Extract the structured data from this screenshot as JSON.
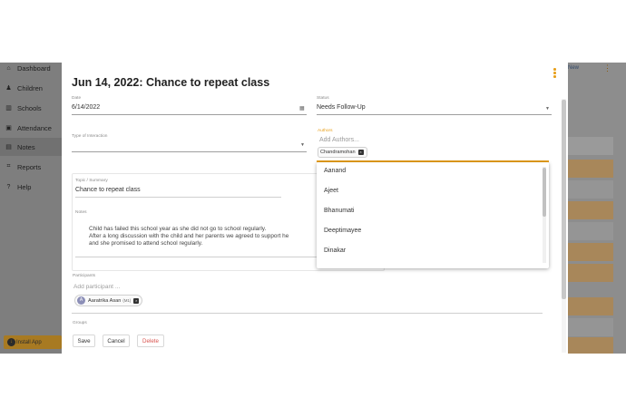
{
  "sidebar": {
    "items": [
      {
        "icon": "home-icon",
        "glyph": "⌂",
        "label": "Dashboard"
      },
      {
        "icon": "child-icon",
        "glyph": "♟",
        "label": "Children"
      },
      {
        "icon": "school-icon",
        "glyph": "▥",
        "label": "Schools"
      },
      {
        "icon": "attendance-icon",
        "glyph": "▣",
        "label": "Attendance"
      },
      {
        "icon": "notes-icon",
        "glyph": "▤",
        "label": "Notes"
      },
      {
        "icon": "chart-icon",
        "glyph": "⌗",
        "label": "Reports"
      },
      {
        "icon": "help-icon",
        "glyph": "?",
        "label": "Help"
      }
    ],
    "install_label": "Install App"
  },
  "background": {
    "new_label": "New"
  },
  "dialog": {
    "title": "Jun 14, 2022: Chance to repeat class",
    "date": {
      "label": "Date",
      "value": "6/14/2022"
    },
    "status": {
      "label": "Status",
      "value": "Needs Follow-Up"
    },
    "type_of_interaction": {
      "label": "Type of Interaction",
      "value": ""
    },
    "authors": {
      "label": "Authors",
      "placeholder": "Add Authors...",
      "chip": "Chandramohan"
    },
    "topic": {
      "label": "Topic / Summary",
      "value": "Chance to repeat class"
    },
    "notes": {
      "label": "Notes",
      "lines": [
        "Child has failed this school year as she did not go to school regularly.",
        "After a long discussion with the child and her parents we agreed to support he",
        "and she promised to attend school regularly."
      ]
    },
    "participants": {
      "label": "Participants",
      "placeholder": "Add participant ...",
      "chip_name": "Aaratrika Asan",
      "chip_sub": "(M1)"
    },
    "groups": {
      "label": "Groups"
    },
    "buttons": {
      "save": "Save",
      "cancel": "Cancel",
      "delete": "Delete"
    }
  },
  "authors_dropdown": {
    "options": [
      "Aanand",
      "Ajeet",
      "Bhanumati",
      "Deeptimayee",
      "Dinakar"
    ]
  },
  "colors": {
    "accent": "#e8a01c",
    "delete": "#d9534f",
    "overlay": "#8f8f8f"
  }
}
